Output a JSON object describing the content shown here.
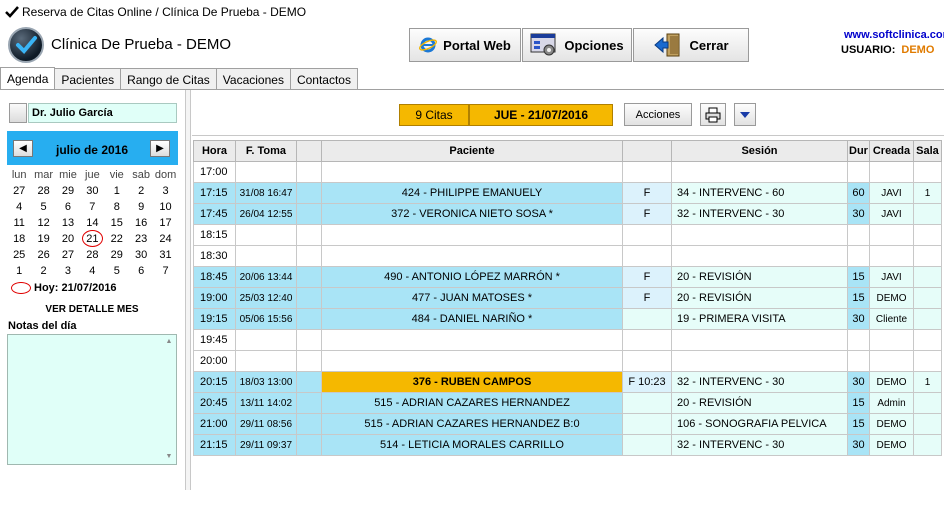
{
  "window": {
    "title": "Reserva de Citas Online / Clínica De Prueba - DEMO"
  },
  "header": {
    "clinic_name": "Clínica De Prueba - DEMO",
    "buttons": {
      "portal": "Portal Web",
      "opciones": "Opciones",
      "cerrar": "Cerrar"
    },
    "site": "www.softclinica.com",
    "user_label": "USUARIO:",
    "user_value": "DEMO"
  },
  "tabs": [
    "Agenda",
    "Pacientes",
    "Rango de Citas",
    "Vacaciones",
    "Contactos"
  ],
  "left": {
    "doctor": "Dr. Julio García",
    "calendar": {
      "month": "julio de 2016",
      "prev": "◀",
      "next": "▶",
      "dow": [
        "lun",
        "mar",
        "mie",
        "jue",
        "vie",
        "sab",
        "dom"
      ],
      "weeks": [
        [
          "27",
          "28",
          "29",
          "30",
          "1",
          "2",
          "3"
        ],
        [
          "4",
          "5",
          "6",
          "7",
          "8",
          "9",
          "10"
        ],
        [
          "11",
          "12",
          "13",
          "14",
          "15",
          "16",
          "17"
        ],
        [
          "18",
          "19",
          "20",
          "21",
          "22",
          "23",
          "24"
        ],
        [
          "25",
          "26",
          "27",
          "28",
          "29",
          "30",
          "31"
        ],
        [
          "1",
          "2",
          "3",
          "4",
          "5",
          "6",
          "7"
        ]
      ],
      "today_label": "Hoy: 21/07/2016"
    },
    "ver_detalle": "VER DETALLE MES",
    "notas_label": "Notas del día"
  },
  "toolbar": {
    "citas": "9 Citas",
    "date": "JUE - 21/07/2016",
    "acciones": "Acciones"
  },
  "schedule": {
    "headers": [
      "Hora",
      "F. Toma",
      "",
      "Paciente",
      "",
      "Sesión",
      "Dur",
      "Creada",
      "Sala"
    ],
    "rows": [
      {
        "hora": "17:00",
        "ftoma": "",
        "paciente": "",
        "f": "",
        "sesion": "",
        "dur": "",
        "creada": "",
        "sala": "",
        "type": "empty"
      },
      {
        "hora": "17:15",
        "ftoma": "31/08 16:47",
        "paciente": "424 - PHILIPPE EMANUELY",
        "f": "F",
        "sesion": "34 - INTERVENC - 60",
        "dur": "60",
        "creada": "JAVI",
        "sala": "1",
        "type": "booked"
      },
      {
        "hora": "17:45",
        "ftoma": "26/04 12:55",
        "paciente": "372 - VERONICA NIETO SOSA  *",
        "f": "F",
        "sesion": "32 - INTERVENC - 30",
        "dur": "30",
        "creada": "JAVI",
        "sala": "",
        "type": "booked"
      },
      {
        "hora": "18:15",
        "ftoma": "",
        "paciente": "",
        "f": "",
        "sesion": "",
        "dur": "",
        "creada": "",
        "sala": "",
        "type": "empty"
      },
      {
        "hora": "18:30",
        "ftoma": "",
        "paciente": "",
        "f": "",
        "sesion": "",
        "dur": "",
        "creada": "",
        "sala": "",
        "type": "empty"
      },
      {
        "hora": "18:45",
        "ftoma": "20/06 13:44",
        "paciente": "490 - ANTONIO LÓPEZ MARRÓN  *",
        "f": "F",
        "sesion": "20 - REVISIÓN",
        "dur": "15",
        "creada": "JAVI",
        "sala": "",
        "type": "booked"
      },
      {
        "hora": "19:00",
        "ftoma": "25/03 12:40",
        "paciente": "477 - JUAN MATOSES  *",
        "f": "F",
        "sesion": "20 - REVISIÓN",
        "dur": "15",
        "creada": "DEMO",
        "sala": "",
        "type": "booked"
      },
      {
        "hora": "19:15",
        "ftoma": "05/06 15:56",
        "paciente": "484 - DANIEL NARIÑO  *",
        "f": "",
        "sesion": "19 - PRIMERA VISITA",
        "dur": "30",
        "creada": "Cliente",
        "sala": "",
        "type": "booked"
      },
      {
        "hora": "19:45",
        "ftoma": "",
        "paciente": "",
        "f": "",
        "sesion": "",
        "dur": "",
        "creada": "",
        "sala": "",
        "type": "empty"
      },
      {
        "hora": "20:00",
        "ftoma": "",
        "paciente": "",
        "f": "",
        "sesion": "",
        "dur": "",
        "creada": "",
        "sala": "",
        "type": "empty"
      },
      {
        "hora": "20:15",
        "ftoma": "18/03 13:00",
        "paciente": "376 - RUBEN CAMPOS",
        "f": "F  10:23",
        "sesion": "32 - INTERVENC - 30",
        "dur": "30",
        "creada": "DEMO",
        "sala": "1",
        "type": "hi"
      },
      {
        "hora": "20:45",
        "ftoma": "13/11 14:02",
        "paciente": "515 - ADRIAN CAZARES HERNANDEZ",
        "f": "",
        "sesion": "20 - REVISIÓN",
        "dur": "15",
        "creada": "Admin",
        "sala": "",
        "type": "booked"
      },
      {
        "hora": "21:00",
        "ftoma": "29/11 08:56",
        "paciente": "515 - ADRIAN CAZARES HERNANDEZ  B:0",
        "f": "",
        "sesion": "106 - SONOGRAFIA PELVICA",
        "dur": "15",
        "creada": "DEMO",
        "sala": "",
        "type": "booked"
      },
      {
        "hora": "21:15",
        "ftoma": "29/11 09:37",
        "paciente": "514 - LETICIA  MORALES CARRILLO",
        "f": "",
        "sesion": "32 - INTERVENC - 30",
        "dur": "30",
        "creada": "DEMO",
        "sala": "",
        "type": "booked"
      }
    ]
  },
  "colors": {
    "accent": "#f5b800",
    "calendar_header": "#27aef0",
    "booked": "#a9e4f6",
    "light": "#e6fdf9",
    "user": "#e07b00",
    "link": "#0000cc"
  },
  "icons": [
    "check-icon",
    "logo-icon",
    "ie-icon",
    "opciones-icon",
    "cerrar-icon",
    "print-icon",
    "dropdown-icon"
  ]
}
